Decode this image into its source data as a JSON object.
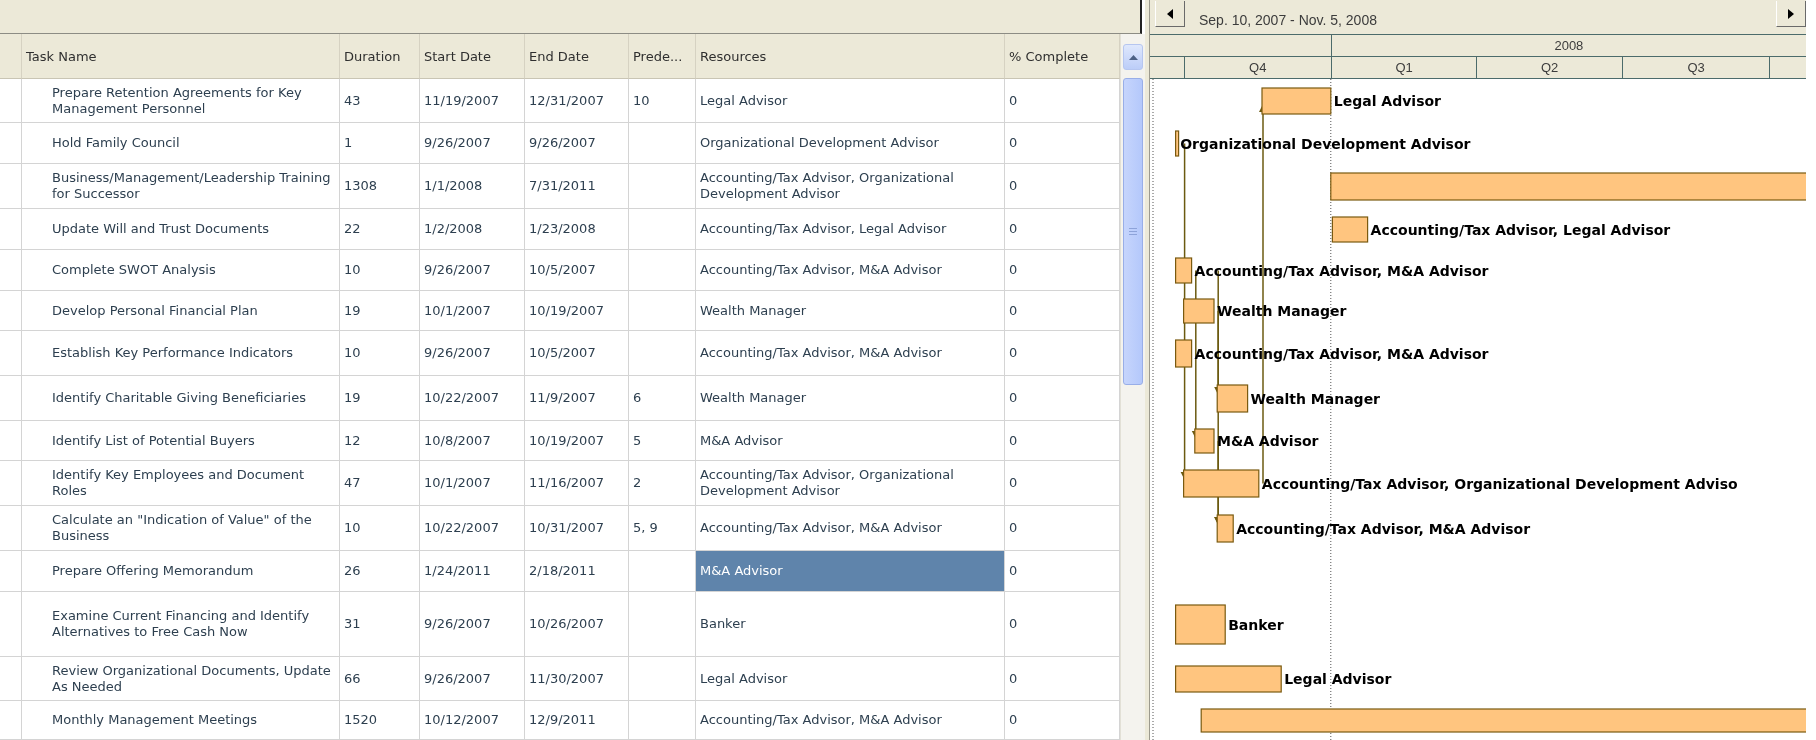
{
  "table": {
    "columns": [
      "Task Name",
      "Duration",
      "Start Date",
      "End Date",
      "Prede...",
      "Resources",
      "% Complete"
    ],
    "rows": [
      {
        "task": "Prepare Retention Agreements for Key Management Personnel",
        "duration": "43",
        "start": "11/19/2007",
        "end": "12/31/2007",
        "predecessors": "10",
        "resources": "Legal Advisor",
        "complete": "0",
        "resource_selected": false,
        "bar_label": "Legal Advisor"
      },
      {
        "task": "Hold Family Council",
        "duration": "1",
        "start": "9/26/2007",
        "end": "9/26/2007",
        "resources": "Organizational Development Advisor",
        "complete": "0",
        "resource_selected": false,
        "bar_label": "Organizational Development Advisor"
      },
      {
        "task": "Business/Management/Leadership Training for Successor",
        "duration": "1308",
        "start": "1/1/2008",
        "end": "7/31/2011",
        "resources": "Accounting/Tax Advisor, Organizational Development Advisor",
        "complete": "0",
        "resource_selected": false
      },
      {
        "task": "Update Will and Trust Documents",
        "duration": "22",
        "start": "1/2/2008",
        "end": "1/23/2008",
        "resources": "Accounting/Tax Advisor, Legal Advisor",
        "complete": "0",
        "resource_selected": false,
        "bar_label": "Accounting/Tax Advisor, Legal Advisor"
      },
      {
        "task": "Complete SWOT Analysis",
        "duration": "10",
        "start": "9/26/2007",
        "end": "10/5/2007",
        "resources": "Accounting/Tax Advisor, M&A Advisor",
        "complete": "0",
        "resource_selected": false,
        "bar_label": "Accounting/Tax Advisor, M&A Advisor"
      },
      {
        "task": "Develop Personal Financial Plan",
        "duration": "19",
        "start": "10/1/2007",
        "end": "10/19/2007",
        "resources": "Wealth Manager",
        "complete": "0",
        "resource_selected": false,
        "bar_label": "Wealth Manager"
      },
      {
        "task": "Establish Key Performance Indicators",
        "duration": "10",
        "start": "9/26/2007",
        "end": "10/5/2007",
        "resources": "Accounting/Tax Advisor, M&A Advisor",
        "complete": "0",
        "resource_selected": false,
        "bar_label": "Accounting/Tax Advisor, M&A Advisor"
      },
      {
        "task": "Identify Charitable Giving Beneficiaries",
        "duration": "19",
        "start": "10/22/2007",
        "end": "11/9/2007",
        "predecessors": "6",
        "resources": "Wealth Manager",
        "complete": "0",
        "resource_selected": false,
        "bar_label": "Wealth Manager"
      },
      {
        "task": "Identify List of Potential Buyers",
        "duration": "12",
        "start": "10/8/2007",
        "end": "10/19/2007",
        "predecessors": "5",
        "resources": "M&A Advisor",
        "complete": "0",
        "resource_selected": false,
        "bar_label": "M&A Advisor"
      },
      {
        "task": "Identify Key Employees and Document Roles",
        "duration": "47",
        "start": "10/1/2007",
        "end": "11/16/2007",
        "predecessors": "2",
        "resources": "Accounting/Tax Advisor, Organizational Development Advisor",
        "complete": "0",
        "resource_selected": false,
        "bar_label": "Accounting/Tax Advisor, Organizational Development Adviso"
      },
      {
        "task": "Calculate an \"Indication of Value\" of the Business",
        "duration": "10",
        "start": "10/22/2007",
        "end": "10/31/2007",
        "predecessors": "5, 9",
        "resources": "Accounting/Tax Advisor, M&A Advisor",
        "complete": "0",
        "resource_selected": false,
        "bar_label": "Accounting/Tax Advisor, M&A Advisor"
      },
      {
        "task": "Prepare Offering Memorandum",
        "duration": "26",
        "start": "1/24/2011",
        "end": "2/18/2011",
        "resources": "M&A Advisor",
        "complete": "0",
        "resource_selected": true
      },
      {
        "task": "Examine Current Financing and Identify Alternatives to Free Cash Now",
        "duration": "31",
        "start": "9/26/2007",
        "end": "10/26/2007",
        "resources": "Banker",
        "complete": "0",
        "resource_selected": false,
        "bar_label": "Banker"
      },
      {
        "task": "Review Organizational Documents, Update As Needed",
        "duration": "66",
        "start": "9/26/2007",
        "end": "11/30/2007",
        "resources": "Legal Advisor",
        "complete": "0",
        "resource_selected": false,
        "bar_label": "Legal Advisor"
      },
      {
        "task": "Monthly Management Meetings",
        "duration": "1520",
        "start": "10/12/2007",
        "end": "12/9/2011",
        "resources": "Accounting/Tax Advisor, M&A Advisor",
        "complete": "0",
        "resource_selected": false
      }
    ]
  },
  "gantt": {
    "range": "Sep. 10, 2007 - Nov. 5, 2008",
    "year": "2008",
    "quarters": [
      "Q4",
      "Q1",
      "Q2",
      "Q3"
    ]
  }
}
